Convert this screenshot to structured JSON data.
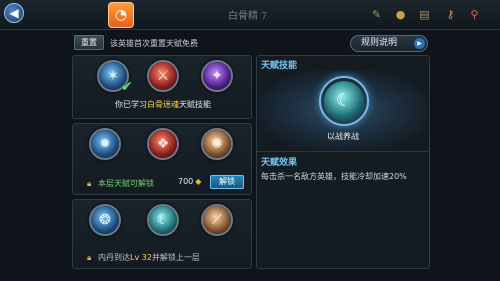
{
  "header": {
    "hero_name": "白骨精",
    "level": "7",
    "tab_icon": "hero-skill-icon"
  },
  "top_icons": [
    "scroll-icon",
    "gold-orb-icon",
    "book-icon",
    "key-icon",
    "search-icon"
  ],
  "reset": {
    "button_label": "重置",
    "note": "该英雄首次重置天赋免费"
  },
  "rules_button": "规则说明",
  "tiers": [
    {
      "talents": [
        {
          "icon": "talent-blue-claw-icon",
          "color": "blue",
          "learned": true
        },
        {
          "icon": "talent-red-blade-icon",
          "color": "red",
          "learned": false
        },
        {
          "icon": "talent-purple-wing-icon",
          "color": "purple",
          "learned": false
        }
      ],
      "learned_prefix": "你已学习",
      "learned_highlight": "白骨迷魂",
      "learned_suffix": "天赋技能"
    },
    {
      "talents": [
        {
          "icon": "talent-blue-spirit-icon",
          "color": "blue"
        },
        {
          "icon": "talent-red-fang-icon",
          "color": "red"
        },
        {
          "icon": "talent-bronze-rune-icon",
          "color": "bronze"
        }
      ],
      "status": "本层天赋可解锁",
      "cost": "700",
      "unlock_label": "解锁"
    },
    {
      "talents": [
        {
          "icon": "talent-blue-flame-icon",
          "color": "blue"
        },
        {
          "icon": "talent-teal-crescent-icon",
          "color": "teal"
        },
        {
          "icon": "talent-bronze-slash-icon",
          "color": "bronze"
        }
      ],
      "lock_prefix": "内丹到达",
      "lock_level": "Lv 32",
      "lock_suffix": "并解锁上一层"
    }
  ],
  "detail": {
    "skill_title": "天赋技能",
    "skill_name": "以战养战",
    "effect_title": "天赋效果",
    "effect_text": "每击杀一名敌方英雄，技能冷却加速20%"
  }
}
